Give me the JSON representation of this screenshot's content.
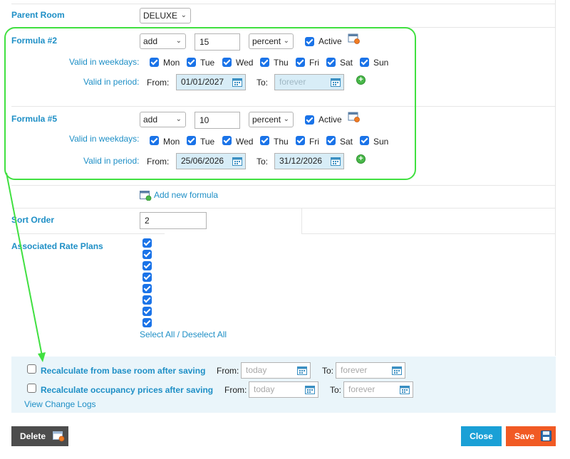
{
  "parent_room": {
    "label": "Parent Room",
    "value": "DELUXE"
  },
  "weekdays": [
    "Mon",
    "Tue",
    "Wed",
    "Thu",
    "Fri",
    "Sat",
    "Sun"
  ],
  "formulas": [
    {
      "title": "Formula #2",
      "operation": "add",
      "amount": "15",
      "unit": "percent",
      "active_label": "Active",
      "weekdays_label": "Valid in weekdays:",
      "period_label": "Valid in period:",
      "from_label": "From:",
      "from_value": "01/01/2027",
      "to_label": "To:",
      "to_placeholder": "forever",
      "to_value": ""
    },
    {
      "title": "Formula #5",
      "operation": "add",
      "amount": "10",
      "unit": "percent",
      "active_label": "Active",
      "weekdays_label": "Valid in weekdays:",
      "period_label": "Valid in period:",
      "from_label": "From:",
      "from_value": "25/06/2026",
      "to_label": "To:",
      "to_value": "31/12/2026"
    }
  ],
  "add_formula_label": "Add new formula",
  "sort_order": {
    "label": "Sort Order",
    "value": "2"
  },
  "rate_plans": {
    "label": "Associated Rate Plans",
    "select_all": "Select All",
    "separator": " / ",
    "deselect_all": "Deselect All"
  },
  "recalc": [
    {
      "label": "Recalculate from base room after saving",
      "from_label": "From:",
      "from_placeholder": "today",
      "to_label": "To:",
      "to_placeholder": "forever"
    },
    {
      "label": "Recalculate occupancy prices after saving",
      "from_label": "From:",
      "from_placeholder": "today",
      "to_label": "To:",
      "to_placeholder": "forever"
    }
  ],
  "view_change_logs": "View Change Logs",
  "buttons": {
    "delete": "Delete",
    "close": "Close",
    "save": "Save"
  },
  "colors": {
    "link": "#1e8fc6",
    "annotation": "#40e040",
    "close": "#1aa0d6",
    "save": "#f15a24",
    "delete": "#4d4d4d"
  }
}
